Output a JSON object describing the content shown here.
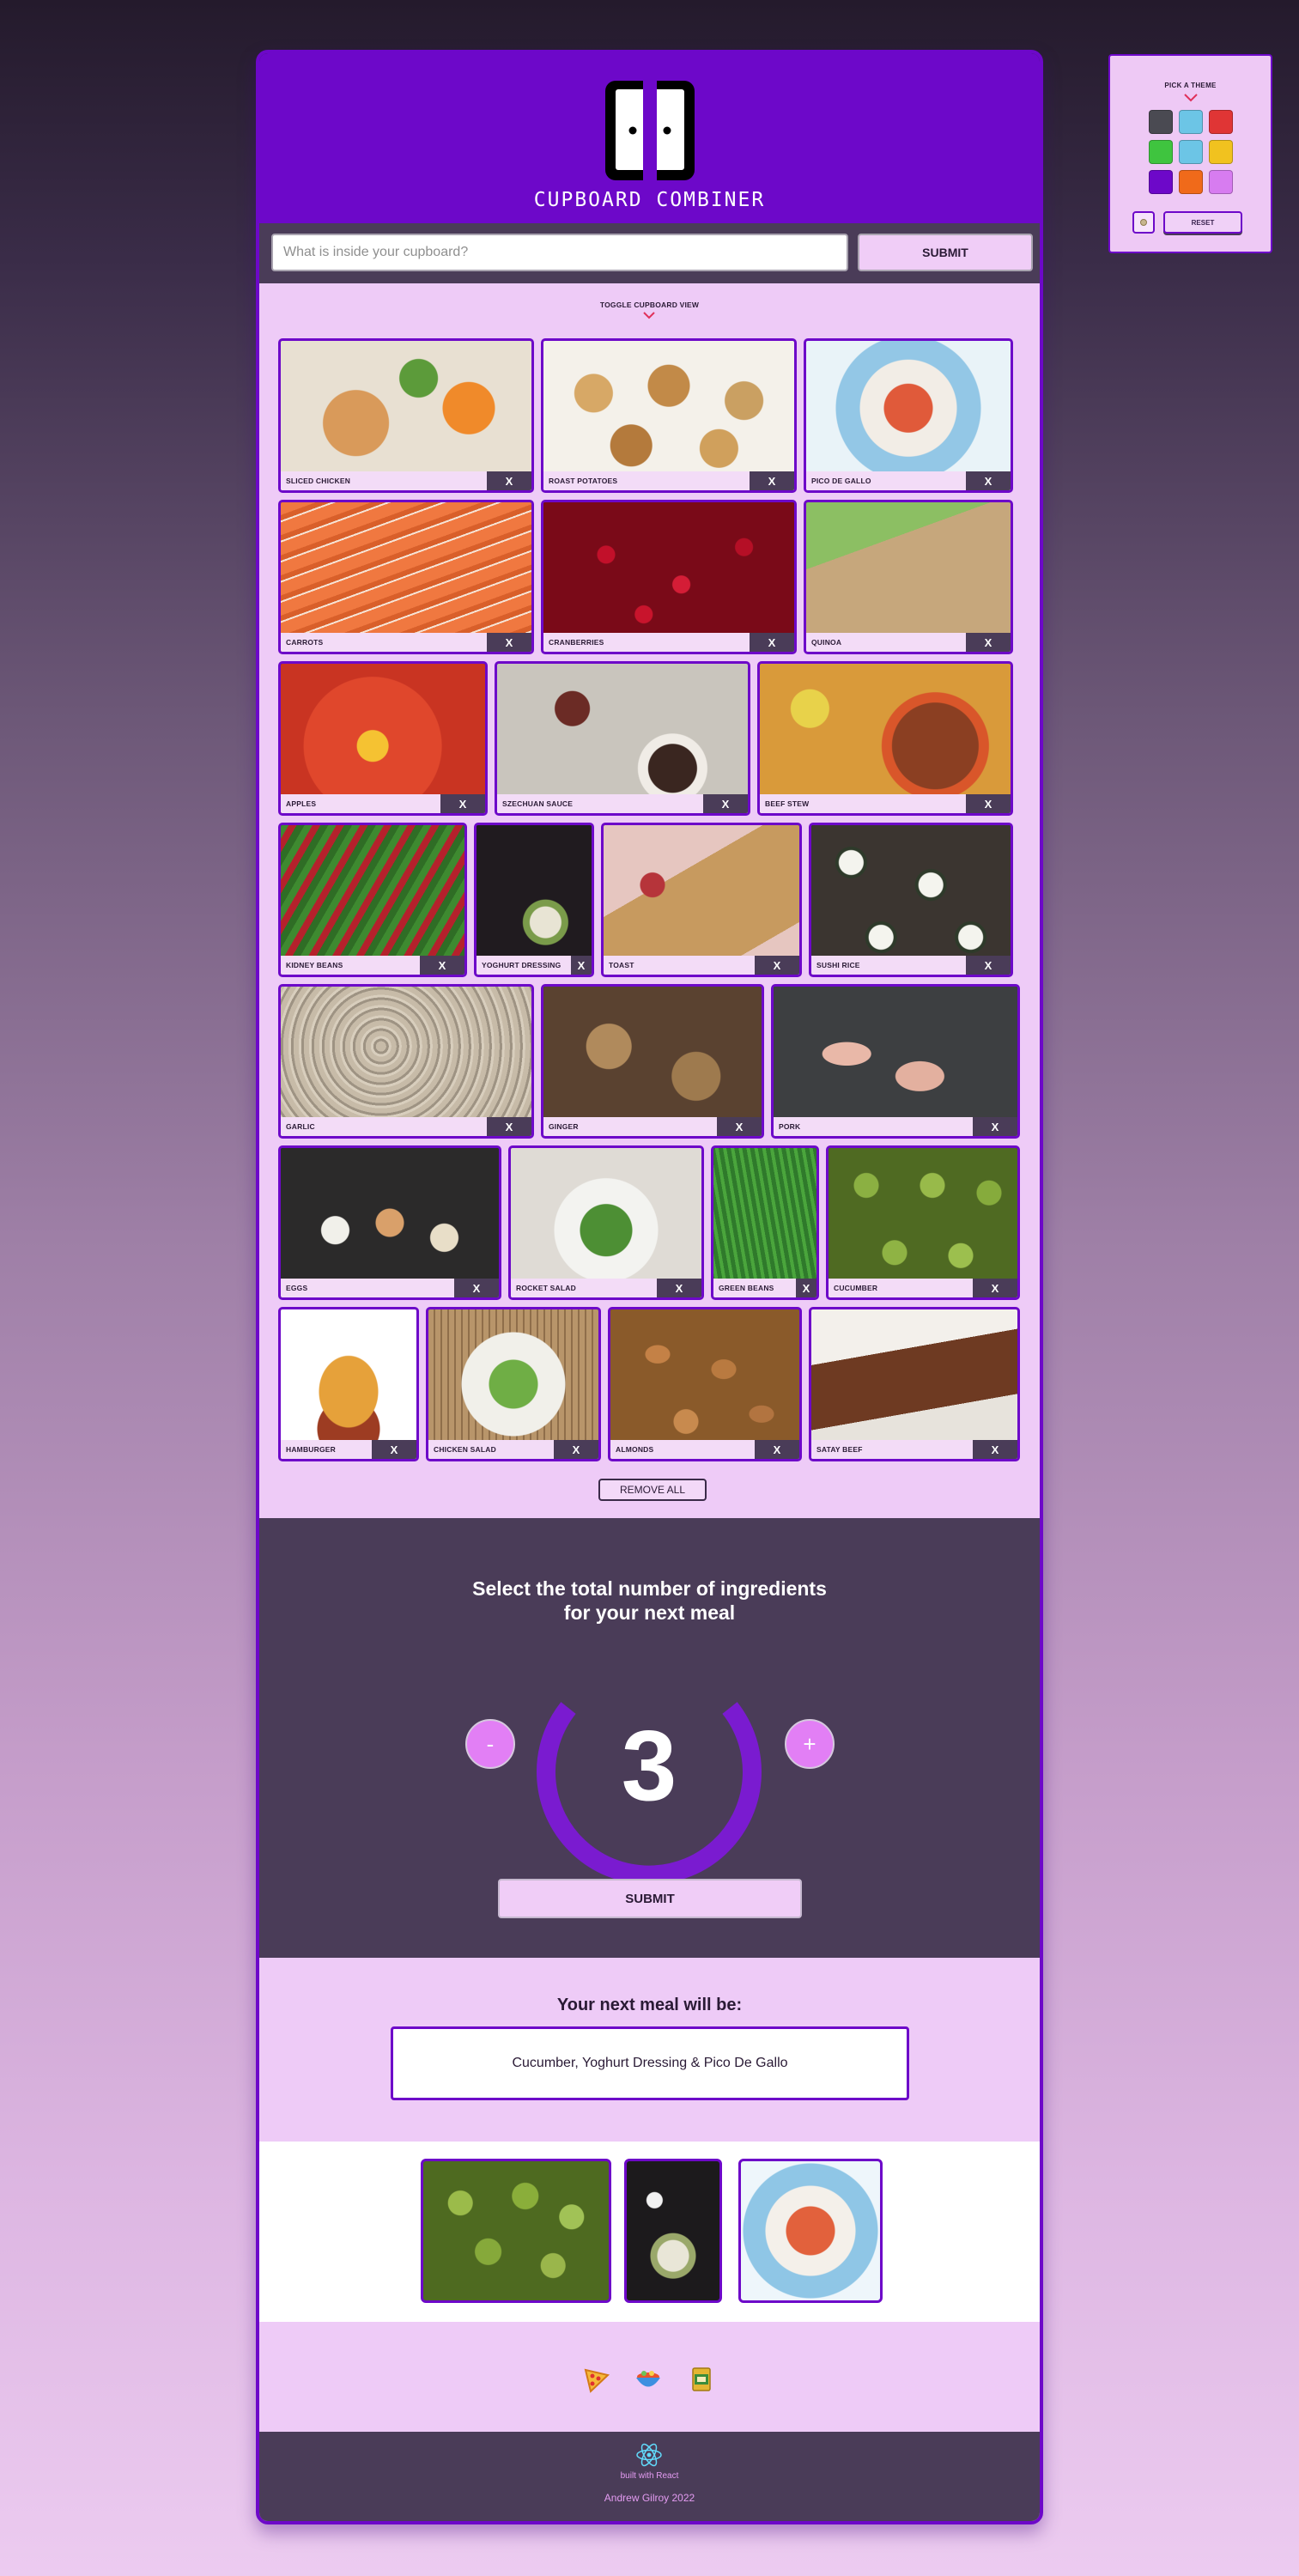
{
  "theme_picker": {
    "title": "PICK A THEME",
    "swatches": [
      "#4a4a52",
      "#6cc5e6",
      "#e03535",
      "#3fc43f",
      "#6cc5e6",
      "#f1c21f",
      "#6d08c9",
      "#f06a1a",
      "#d77cf0"
    ],
    "reset_label": "RESET"
  },
  "header": {
    "app_title": "CUPBOARD COMBINER"
  },
  "search": {
    "placeholder": "What is inside your cupboard?",
    "submit_label": "SUBMIT"
  },
  "pantry": {
    "toggle_label": "TOGGLE CUPBOARD VIEW",
    "remove_label": "X",
    "remove_all_label": "REMOVE ALL",
    "rows": [
      [
        {
          "name": "SLICED CHICKEN"
        },
        {
          "name": "ROAST POTATOES"
        },
        {
          "name": "PICO DE GALLO"
        }
      ],
      [
        {
          "name": "CARROTS"
        },
        {
          "name": "CRANBERRIES"
        },
        {
          "name": "QUINOA"
        }
      ],
      [
        {
          "name": "APPLES"
        },
        {
          "name": "SZECHUAN SAUCE"
        },
        {
          "name": "BEEF STEW"
        }
      ],
      [
        {
          "name": "KIDNEY BEANS"
        },
        {
          "name": "YOGHURT DRESSING"
        },
        {
          "name": "TOAST"
        },
        {
          "name": "SUSHI RICE"
        }
      ],
      [
        {
          "name": "GARLIC"
        },
        {
          "name": "GINGER"
        },
        {
          "name": "PORK"
        }
      ],
      [
        {
          "name": "EGGS"
        },
        {
          "name": "ROCKET SALAD"
        },
        {
          "name": "GREEN BEANS"
        },
        {
          "name": "CUCUMBER"
        }
      ],
      [
        {
          "name": "HAMBURGER"
        },
        {
          "name": "CHICKEN SALAD"
        },
        {
          "name": "ALMONDS"
        },
        {
          "name": "SATAY BEEF"
        }
      ]
    ]
  },
  "selector": {
    "title_line1": "Select the total number of ingredients",
    "title_line2": "for your next meal",
    "count": "3",
    "minus_label": "-",
    "plus_label": "+",
    "submit_label": "SUBMIT"
  },
  "result": {
    "title": "Your next meal will be:",
    "meal": "Cucumber, Yoghurt Dressing & Pico De Gallo"
  },
  "icons": [
    "pizza-icon",
    "bowl-icon",
    "tin-can-icon"
  ],
  "footer": {
    "built_with": "built with React",
    "author": "Andrew Gilroy 2022"
  }
}
